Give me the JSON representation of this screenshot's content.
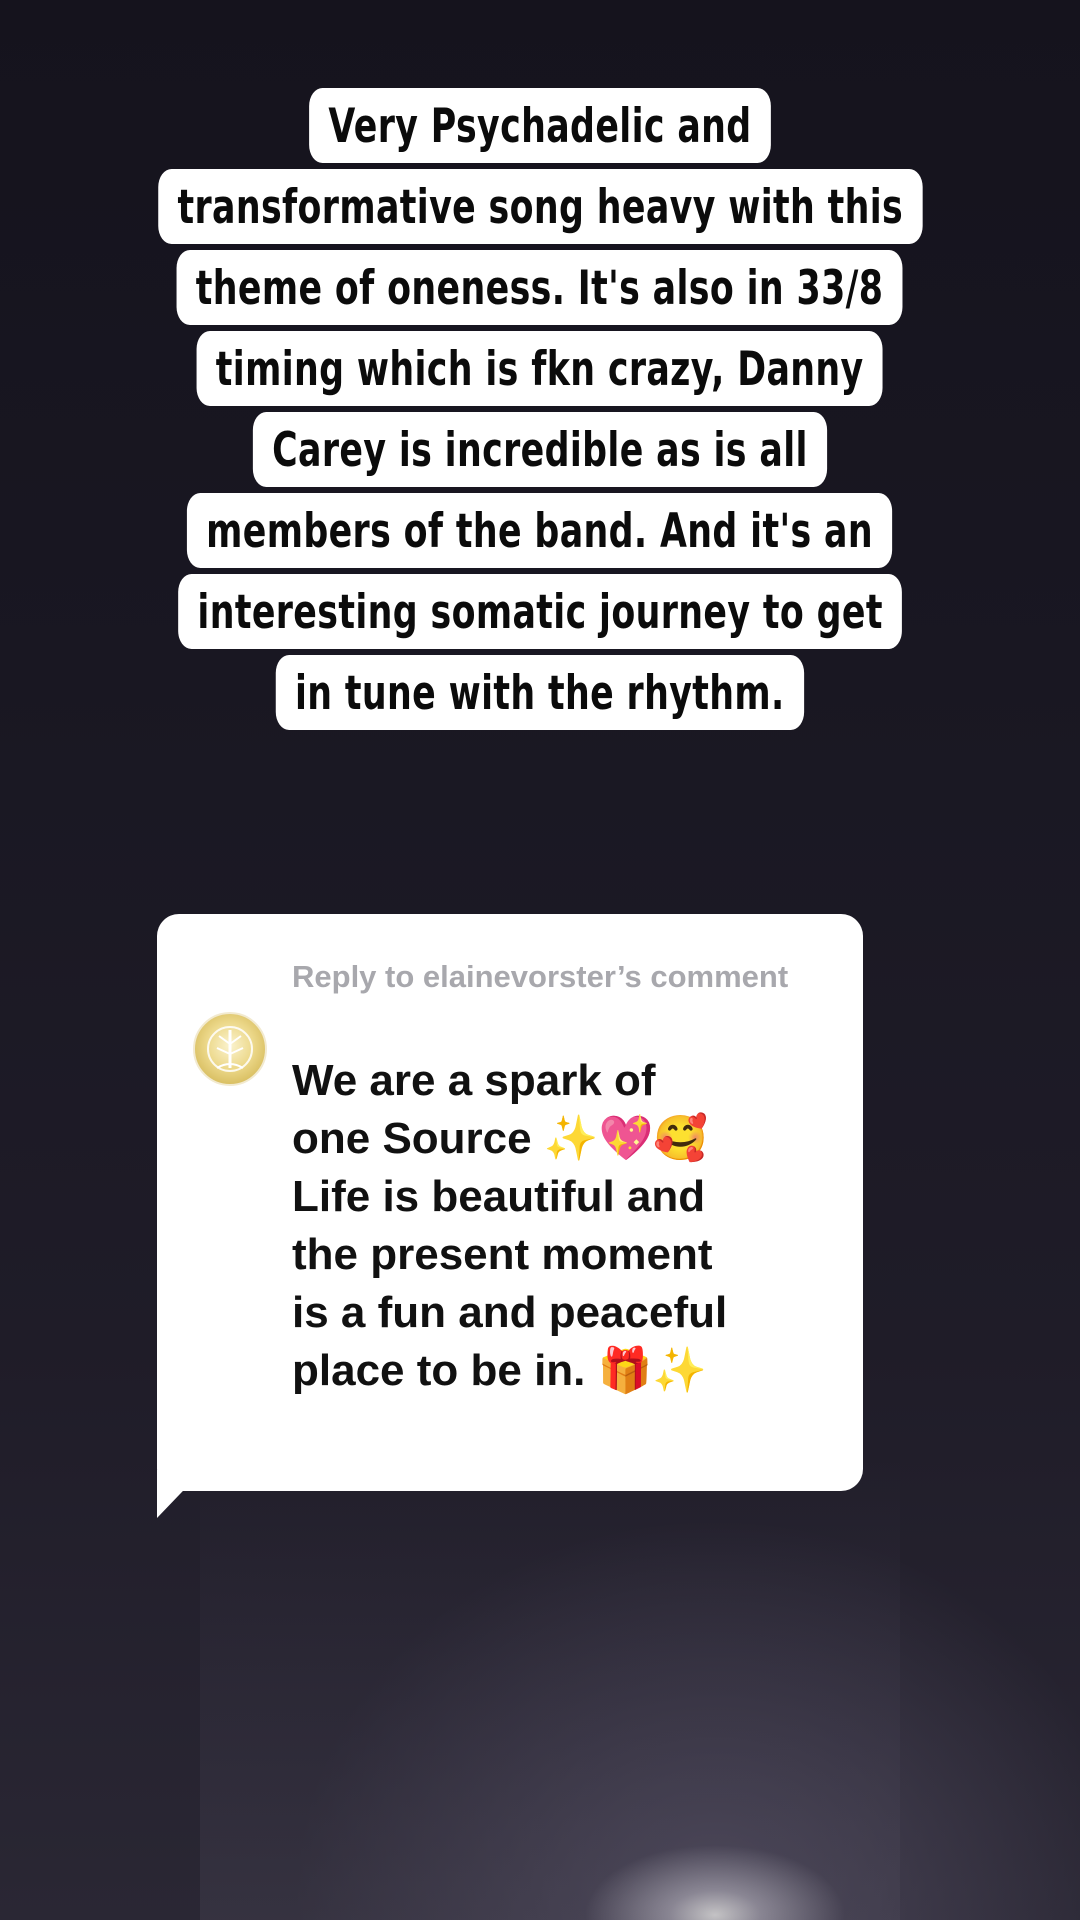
{
  "caption": {
    "lines": [
      "Very Psychadelic and",
      "transformative song heavy with this",
      "theme of oneness. It's also in 33/8",
      "timing which is fkn crazy, Danny",
      "Carey is incredible as is all",
      "members of the band. And it's an",
      "interesting somatic journey to get",
      "in tune with the rhythm."
    ]
  },
  "reply": {
    "label": "Reply to elainevorster’s comment",
    "body_lines": [
      "We are a spark of",
      "one Source ✨💖🥰",
      "Life is beautiful and",
      "the present moment",
      "is a fun and peaceful",
      "place to be in. 🎁✨"
    ],
    "avatar_icon": "tree-of-life-icon"
  },
  "colors": {
    "background": "#14121c",
    "caption_bg": "#ffffff",
    "caption_text": "#0b0b0b",
    "reply_label": "#a8a8ad",
    "reply_text": "#111111"
  }
}
